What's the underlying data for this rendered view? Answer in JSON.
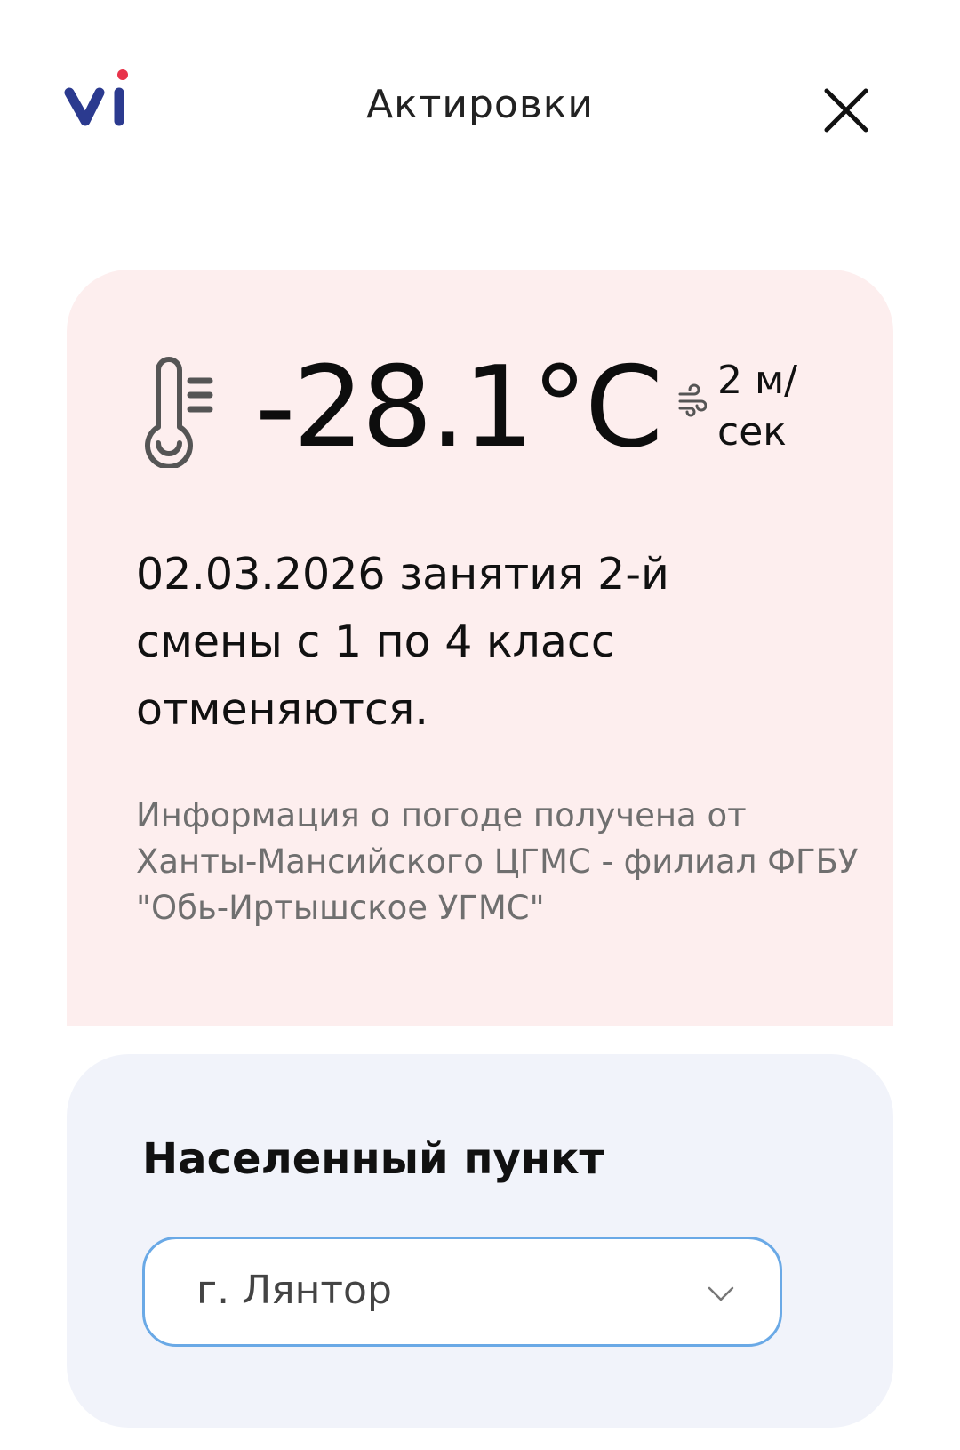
{
  "header": {
    "title": "Актировки",
    "logo_text": "vi",
    "logo_colors": {
      "letters": "#2b3a8f",
      "dot": "#e8334a"
    }
  },
  "weather": {
    "temperature": "-28.1°C",
    "wind": "2 м/сек",
    "alert": "02.03.2026 занятия 2-й смены с 1 по 4 класс отменяются.",
    "source": "Информация о погоде получена от Ханты-Мансийского ЦГМС - филиал ФГБУ \"Обь-Иртышское УГМС\"",
    "icons": [
      "thermometer-icon",
      "wind-icon"
    ],
    "card_color": "#fdeeee"
  },
  "location": {
    "label": "Населенный пункт",
    "selected": "г. Лянтор",
    "card_color": "#f1f3fa",
    "select_border_color": "#6aa9e6"
  }
}
